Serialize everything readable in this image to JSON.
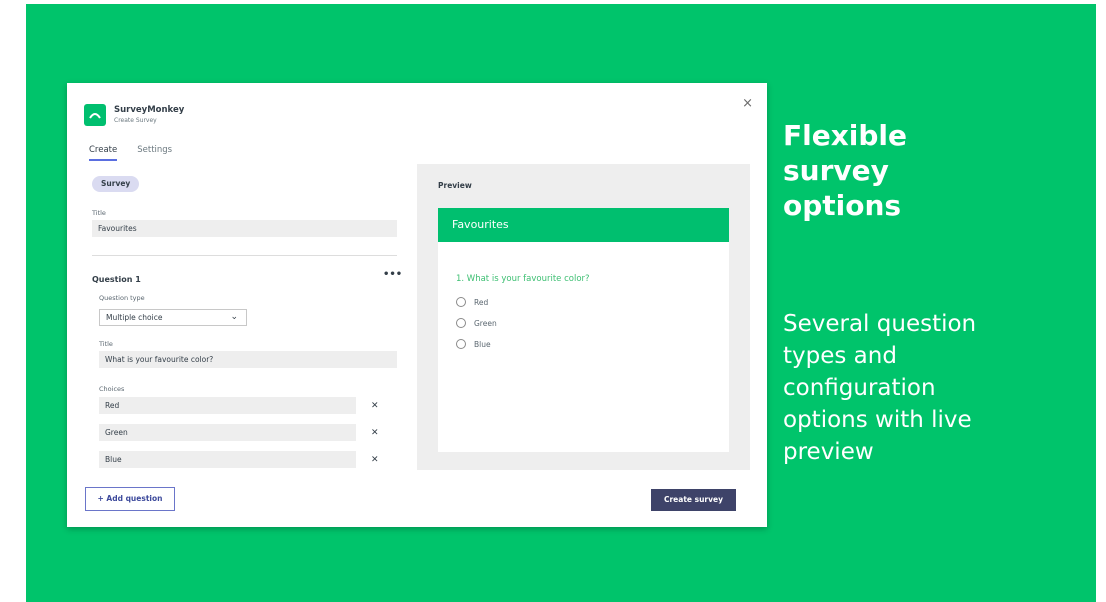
{
  "brand": {
    "name": "SurveyMonkey",
    "subtitle": "Create Survey"
  },
  "tabs": [
    {
      "label": "Create",
      "active": true
    },
    {
      "label": "Settings",
      "active": false
    }
  ],
  "survey_chip": "Survey",
  "survey_title": {
    "label": "Title",
    "value": "Favourites"
  },
  "question": {
    "heading": "Question 1",
    "menu": "•••",
    "type_label": "Question type",
    "type_value": "Multiple choice",
    "title_label": "Title",
    "title_value": "What is your favourite color?",
    "choices_label": "Choices",
    "choices": [
      "Red",
      "Green",
      "Blue"
    ]
  },
  "buttons": {
    "add_question": "+ Add question",
    "create_survey": "Create survey",
    "close": "×",
    "remove": "✕"
  },
  "preview": {
    "label": "Preview",
    "header": "Favourites",
    "question": "1. What is your favourite color?",
    "options": [
      "Red",
      "Green",
      "Blue"
    ]
  },
  "marketing": {
    "headline": [
      "Flexible",
      "survey",
      "options"
    ],
    "subline": [
      "Several question",
      "types and",
      "configuration",
      "options with live",
      "preview"
    ]
  },
  "colors": {
    "background": "#00c46b",
    "brand_green": "#00bf6f",
    "create_button": "#3e4369",
    "accent": "#5a6ee0"
  },
  "icons": {
    "logo": "surveymonkey-logo-icon",
    "close": "close-icon",
    "chevron": "chevron-down-icon",
    "more": "more-icon"
  }
}
